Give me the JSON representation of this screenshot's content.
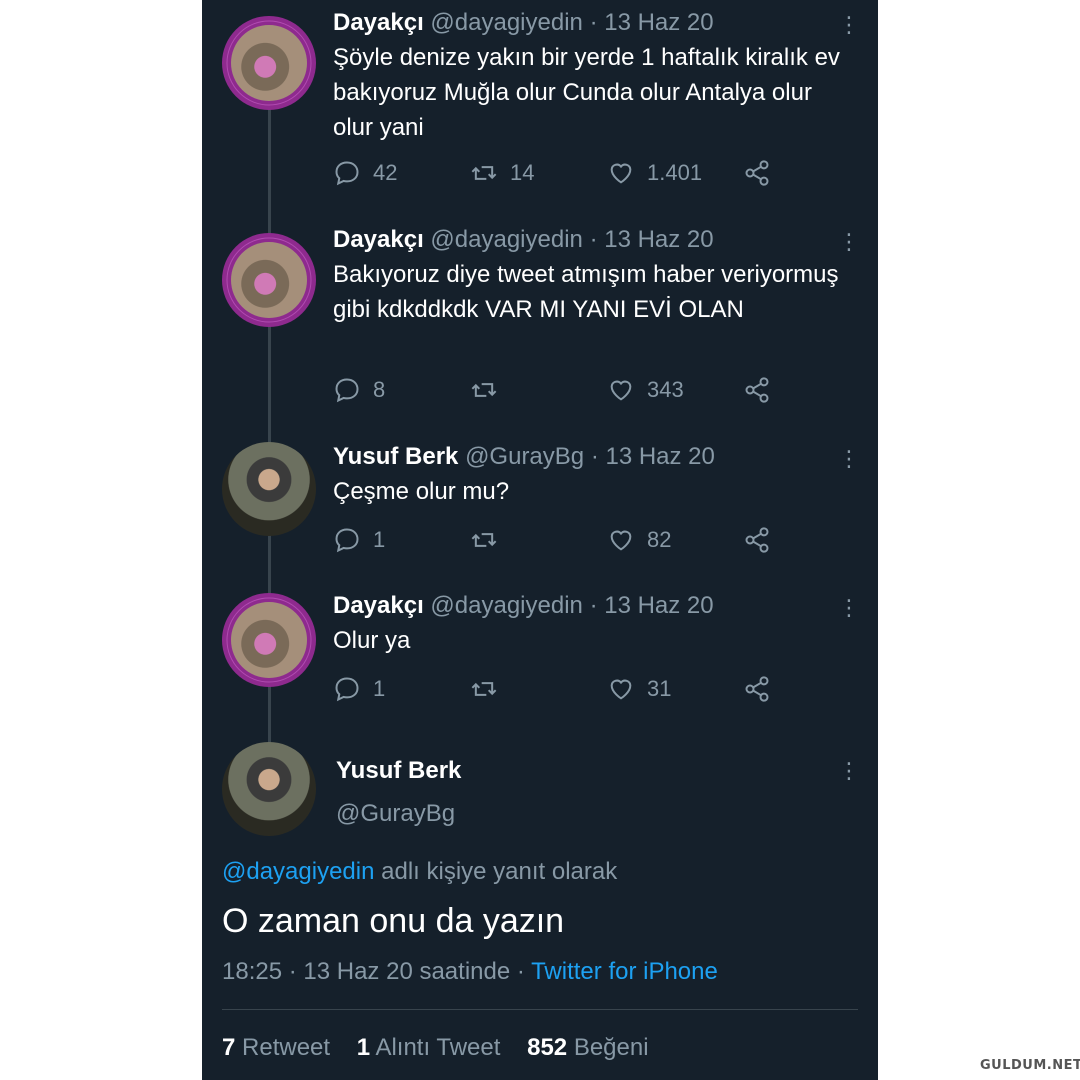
{
  "tweets": [
    {
      "name": "Dayakçı",
      "handle": "@dayagiyedin",
      "date": "· 13 Haz 20",
      "text": "Şöyle denize yakın bir yerde 1 haftalık kiralık ev bakıyoruz Muğla olur Cunda olur Antalya olur olur yani",
      "replies": "42",
      "retweets": "14",
      "likes": "1.401"
    },
    {
      "name": "Dayakçı",
      "handle": "@dayagiyedin",
      "date": "· 13 Haz 20",
      "text": "Bakıyoruz diye tweet atmışım haber veriyormuş gibi kdkddkdk VAR MI YANI EVİ OLAN",
      "replies": "8",
      "retweets": "",
      "likes": "343"
    },
    {
      "name": "Yusuf Berk",
      "handle": "@GurayBg",
      "date": "· 13 Haz 20",
      "text": "Çeşme olur mu?",
      "replies": "1",
      "retweets": "",
      "likes": "82"
    },
    {
      "name": "Dayakçı",
      "handle": "@dayagiyedin",
      "date": "· 13 Haz 20",
      "text": "Olur ya",
      "replies": "1",
      "retweets": "",
      "likes": "31"
    }
  ],
  "detail": {
    "name": "Yusuf Berk",
    "handle": "@GurayBg",
    "replying_link": "@dayagiyedin",
    "replying_rest": " adlı kişiye yanıt olarak",
    "text": "O zaman onu da yazın",
    "meta": "18:25 · 13 Haz 20 saatinde · ",
    "source": "Twitter for iPhone",
    "retweet_count": "7",
    "retweet_label": "Retweet",
    "quote_count": "1",
    "quote_label": "Alıntı Tweet",
    "like_count": "852",
    "like_label": "Beğeni"
  },
  "watermark": "GULDUM.NET",
  "colors": {
    "background": "#15202b",
    "link": "#1da1f2",
    "muted": "#8899a6",
    "line": "#38444d"
  },
  "icons": [
    "reply-icon",
    "retweet-icon",
    "like-icon",
    "share-icon",
    "more-icon"
  ]
}
